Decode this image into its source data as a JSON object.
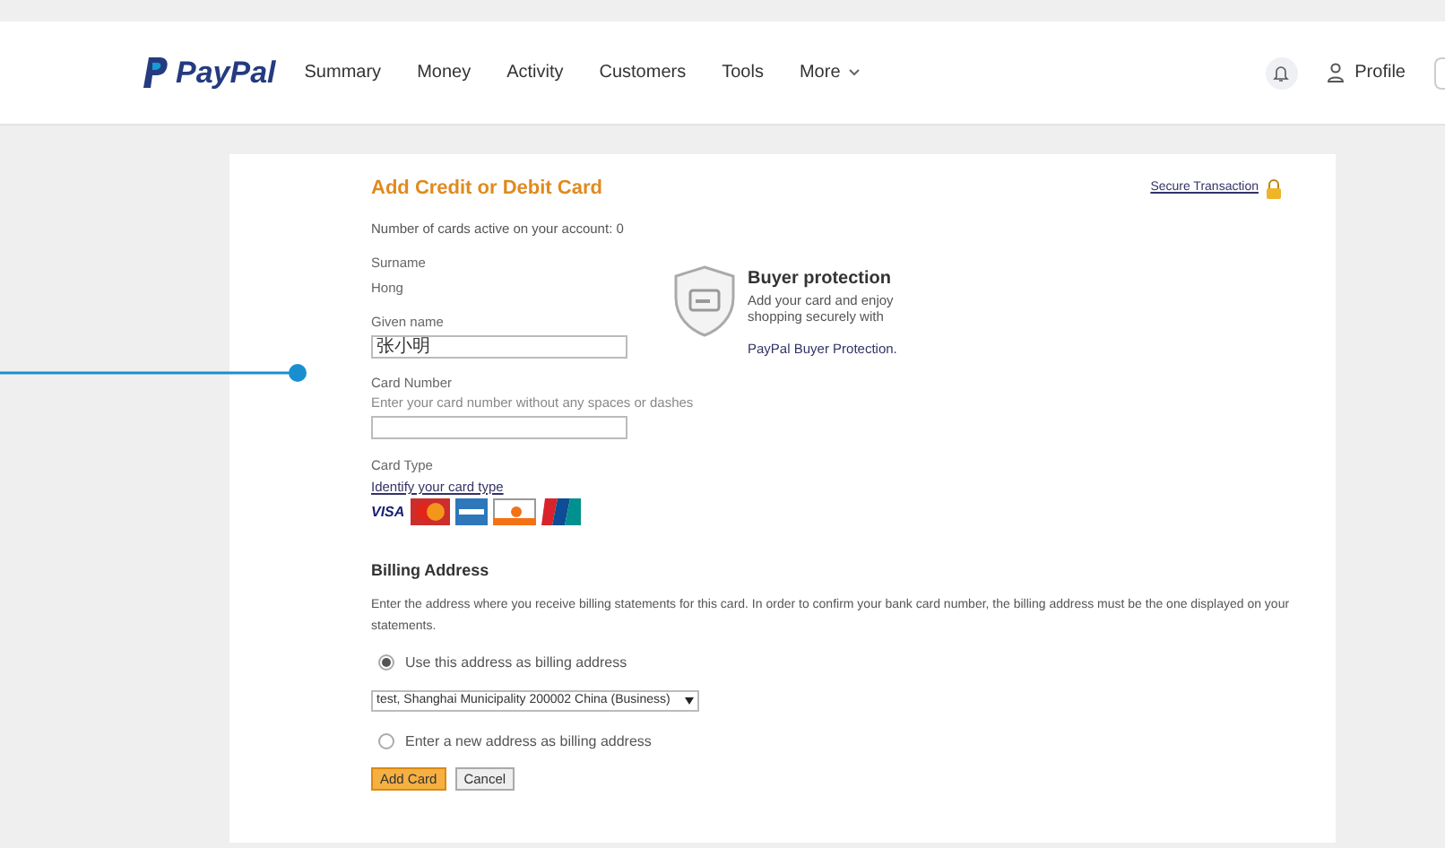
{
  "nav": {
    "logo": "PayPal",
    "items": [
      "Summary",
      "Money",
      "Activity",
      "Customers",
      "Tools",
      "More"
    ],
    "profile": "Profile"
  },
  "form": {
    "title": "Add Credit or Debit Card",
    "secure_link": "Secure Transaction",
    "cards_active": "Number of cards active on your account: 0",
    "surname_label": "Surname",
    "surname": "Hong",
    "given_label": "Given name",
    "given_value": "张小明",
    "card_number_label": "Card Number",
    "card_number_hint": "Enter your card number without any spaces or dashes",
    "card_type_label": "Card Type",
    "identify_link": "Identify your card type",
    "visa": "VISA"
  },
  "protection": {
    "title": "Buyer protection",
    "text": "Add your card and enjoy shopping securely with",
    "link": "PayPal Buyer Protection."
  },
  "billing": {
    "title": "Billing Address",
    "text": "Enter the address where you receive billing statements for this card. In order to confirm your bank card number, the billing address must be the one displayed on your statements.",
    "options": [
      {
        "label": "Use this address as billing address",
        "selected": true
      },
      {
        "label": "Enter a new address as billing address",
        "selected": false
      }
    ],
    "address_select": "test, Shanghai Municipality 200002 China (Business)"
  },
  "buttons": [
    {
      "label": "Add Card",
      "kind": "primary"
    },
    {
      "label": "Cancel",
      "kind": "secondary"
    }
  ]
}
